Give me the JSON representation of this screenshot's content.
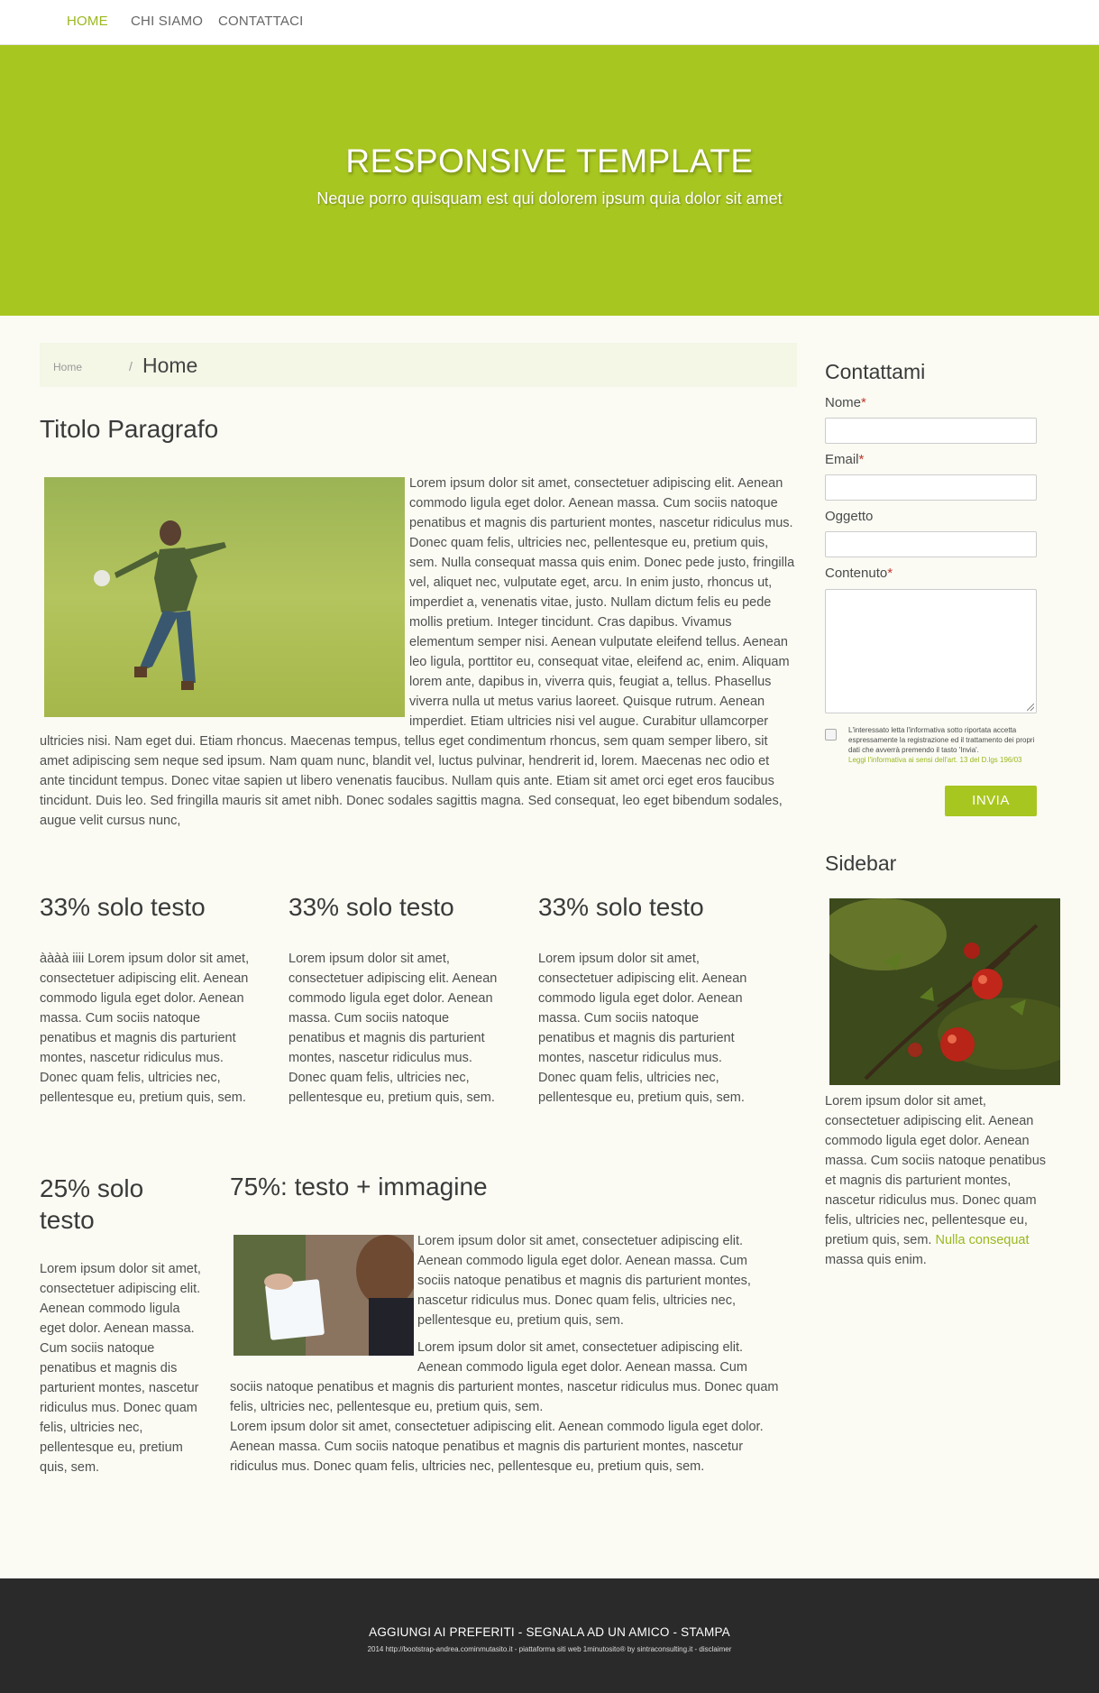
{
  "nav": {
    "items": [
      {
        "label": "HOME"
      },
      {
        "label": "CHI SIAMO"
      },
      {
        "label": "CONTATTACI"
      }
    ]
  },
  "hero": {
    "title": "RESPONSIVE TEMPLATE",
    "subtitle": "Neque porro quisquam est qui dolorem ipsum quia dolor sit amet"
  },
  "breadcrumb": {
    "home": "Home",
    "separator": "/",
    "current": "Home"
  },
  "main": {
    "title": "Titolo Paragrafo",
    "body": "Lorem ipsum dolor sit amet, consectetuer adipiscing elit. Aenean commodo ligula eget dolor. Aenean massa. Cum sociis natoque penatibus et magnis dis parturient montes, nascetur ridiculus mus. Donec quam felis, ultricies nec, pellentesque eu, pretium quis, sem. Nulla consequat massa quis enim. Donec pede justo, fringilla vel, aliquet nec, vulputate eget, arcu. In enim justo, rhoncus ut, imperdiet a, venenatis vitae, justo. Nullam dictum felis eu pede mollis pretium. Integer tincidunt. Cras dapibus. Vivamus elementum semper nisi. Aenean vulputate eleifend tellus. Aenean leo ligula, porttitor eu, consequat vitae, eleifend ac, enim. Aliquam lorem ante, dapibus in, viverra quis, feugiat a, tellus. Phasellus viverra nulla ut metus varius laoreet. Quisque rutrum. Aenean imperdiet. Etiam ultricies nisi vel augue. Curabitur ullamcorper ultricies nisi. Nam eget dui. Etiam rhoncus. Maecenas tempus, tellus eget condimentum rhoncus, sem quam semper libero, sit amet adipiscing sem neque sed ipsum. Nam quam nunc, blandit vel, luctus pulvinar, hendrerit id, lorem. Maecenas nec odio et ante tincidunt tempus. Donec vitae sapien ut libero venenatis faucibus. Nullam quis ante. Etiam sit amet orci eget eros faucibus tincidunt. Duis leo. Sed fringilla mauris sit amet nibh. Donec sodales sagittis magna. Sed consequat, leo eget bibendum sodales, augue velit cursus nunc,"
  },
  "cols33": [
    {
      "title": "33% solo testo",
      "body": "àààà iiii Lorem ipsum dolor sit amet, consectetuer adipiscing elit. Aenean commodo ligula eget dolor. Aenean massa. Cum sociis natoque penatibus et magnis dis parturient montes, nascetur ridiculus mus. Donec quam felis, ultricies nec, pellentesque eu, pretium quis, sem."
    },
    {
      "title": "33% solo testo",
      "body": "Lorem ipsum dolor sit amet, consectetuer adipiscing elit. Aenean commodo ligula eget dolor. Aenean massa. Cum sociis natoque penatibus et magnis dis parturient montes, nascetur ridiculus mus. Donec quam felis, ultricies nec, pellentesque eu, pretium quis, sem."
    },
    {
      "title": "33% solo testo",
      "body": "Lorem ipsum dolor sit amet, consectetuer adipiscing elit. Aenean commodo ligula eget dolor. Aenean massa. Cum sociis natoque penatibus et magnis dis parturient montes, nascetur ridiculus mus. Donec quam felis, ultricies nec, pellentesque eu, pretium quis, sem."
    }
  ],
  "col25": {
    "title": "25% solo testo",
    "body": "Lorem ipsum dolor sit amet, consectetuer adipiscing elit. Aenean commodo ligula eget dolor. Aenean massa. Cum sociis natoque penatibus et magnis dis parturient montes, nascetur ridiculus mus. Donec quam felis, ultricies nec, pellentesque eu, pretium quis, sem."
  },
  "col75": {
    "title": "75%: testo + immagine",
    "p1": "Lorem ipsum dolor sit amet, consectetuer adipiscing elit. Aenean commodo ligula eget dolor. Aenean massa. Cum sociis natoque penatibus et magnis dis parturient montes, nascetur ridiculus mus. Donec quam felis, ultricies nec, pellentesque eu, pretium quis, sem.",
    "p2": "Lorem ipsum dolor sit amet, consectetuer adipiscing elit. Aenean commodo ligula eget dolor. Aenean massa. Cum sociis natoque penatibus et magnis dis parturient montes, nascetur ridiculus mus. Donec quam felis, ultricies nec, pellentesque eu, pretium quis, sem.",
    "p3": "Lorem ipsum dolor sit amet, consectetuer adipiscing elit. Aenean commodo ligula eget dolor. Aenean massa. Cum sociis natoque penatibus et magnis dis parturient montes, nascetur ridiculus mus. Donec quam felis, ultricies nec, pellentesque eu, pretium quis, sem."
  },
  "contact": {
    "title": "Contattami",
    "name_label": "Nome",
    "email_label": "Email",
    "subject_label": "Oggetto",
    "content_label": "Contenuto",
    "required_mark": "*",
    "privacy_text": "L'interessato letta l'informativa sotto riportata accetta espressamente la registrazione ed il trattamento dei propri dati che avverrà premendo il tasto 'Invia'.",
    "privacy_link": "Leggi l'informativa ai sensi dell'art. 13 del D.lgs 196/03",
    "send_label": "INVIA"
  },
  "sidebar": {
    "title": "Sidebar",
    "text_before": "Lorem ipsum dolor sit amet, consectetuer adipiscing elit. Aenean commodo ligula eget dolor. Aenean massa. Cum sociis natoque penatibus et magnis dis parturient montes, nascetur ridiculus mus. Donec quam felis, ultricies nec, pellentesque eu, pretium quis, sem.",
    "link": "Nulla consequat",
    "text_after": "massa quis enim."
  },
  "footer": {
    "links": "AGGIUNGI AI PREFERITI - SEGNALA AD UN AMICO - STAMPA",
    "copyright": "2014 http://bootstrap-andrea.cominmutasito.it - piattaforma siti web 1minutosito® by sintraconsulting.it - disclaimer"
  },
  "colors": {
    "accent": "#a8c620",
    "link": "#9ab81e",
    "footer_bg": "#2a2a2a",
    "page_bg": "#fbfbf4"
  }
}
